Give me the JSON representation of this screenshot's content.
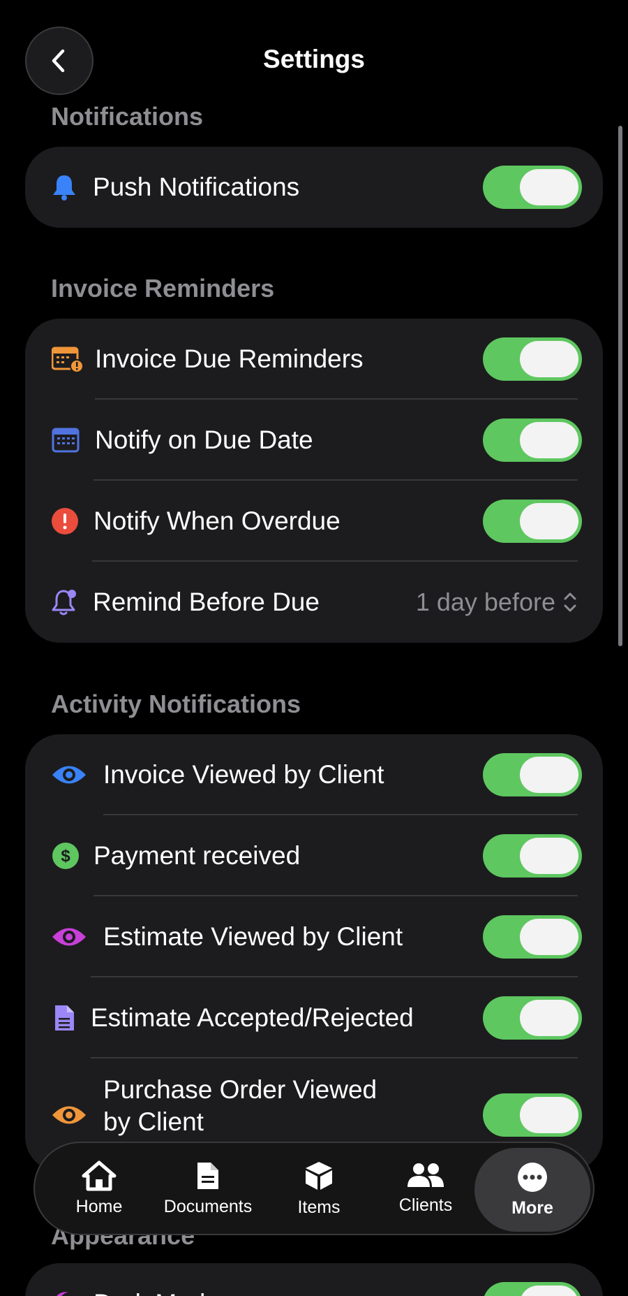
{
  "header": {
    "title": "Settings"
  },
  "sections": {
    "notifications": {
      "title": "Notifications",
      "rows": [
        {
          "label": "Push Notifications",
          "on": true
        }
      ]
    },
    "invoice_reminders": {
      "title": "Invoice Reminders",
      "rows": [
        {
          "label": "Invoice Due Reminders",
          "on": true
        },
        {
          "label": "Notify on Due Date",
          "on": true
        },
        {
          "label": "Notify When Overdue",
          "on": true
        },
        {
          "label": "Remind Before Due",
          "value": "1 day before"
        }
      ]
    },
    "activity_notifications": {
      "title": "Activity Notifications",
      "rows": [
        {
          "label": "Invoice Viewed by Client",
          "on": true
        },
        {
          "label": "Payment received",
          "on": true
        },
        {
          "label": "Estimate Viewed by Client",
          "on": true
        },
        {
          "label": "Estimate Accepted/Rejected",
          "on": true
        },
        {
          "label_line1": "Purchase Order Viewed",
          "label_line2": "by Client",
          "on": true
        }
      ]
    },
    "appearance": {
      "title": "Appearance",
      "rows": [
        {
          "label": "Dark Mode",
          "on": true
        }
      ]
    }
  },
  "tabbar": {
    "tabs": [
      {
        "label": "Home",
        "icon": "house-icon"
      },
      {
        "label": "Documents",
        "icon": "document-icon"
      },
      {
        "label": "Items",
        "icon": "box-icon"
      },
      {
        "label": "Clients",
        "icon": "people-icon"
      },
      {
        "label": "More",
        "icon": "ellipsis-circle-icon",
        "active": true
      }
    ]
  },
  "colors": {
    "toggle_on": "#5ec760",
    "accent_blue": "#3a82f7",
    "accent_orange": "#f0963a",
    "accent_red": "#eb4d3d",
    "accent_purple": "#9b87f5",
    "accent_green": "#5ec760",
    "accent_magenta": "#c840d8"
  }
}
